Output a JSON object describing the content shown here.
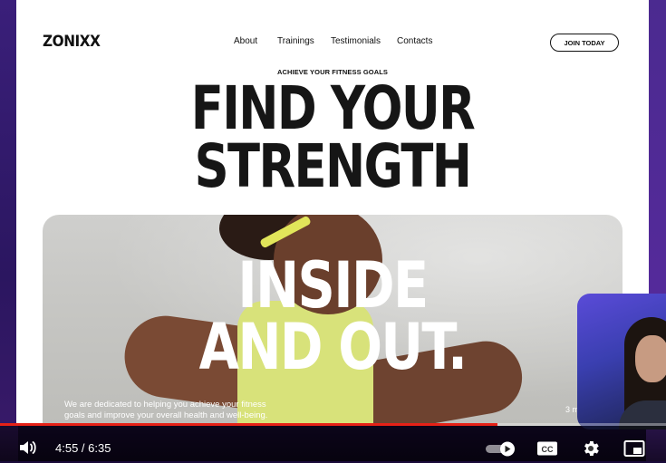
{
  "site": {
    "logo": "ZONIXX",
    "nav": [
      "About",
      "Trainings",
      "Testimonials",
      "Contacts"
    ],
    "join_button": "JOIN TODAY",
    "eyebrow": "ACHIEVE YOUR FITNESS GOALS",
    "headline": [
      "FIND YOUR",
      "STRENGTH"
    ],
    "hero": {
      "overlay": [
        "INSIDE",
        "AND OUT."
      ],
      "description": "We are dedicated to helping you achieve your fitness goals and improve your overall health and well-being.",
      "meta": "3 min"
    }
  },
  "player": {
    "current_time": "4:55",
    "duration": "6:35",
    "time_display": "4:55 / 6:35",
    "progress_fraction": 0.747,
    "colors": {
      "progress": "#e62117"
    },
    "icons": [
      "volume-icon",
      "autoplay-toggle-icon",
      "captions-icon",
      "settings-icon",
      "miniplayer-icon"
    ]
  }
}
